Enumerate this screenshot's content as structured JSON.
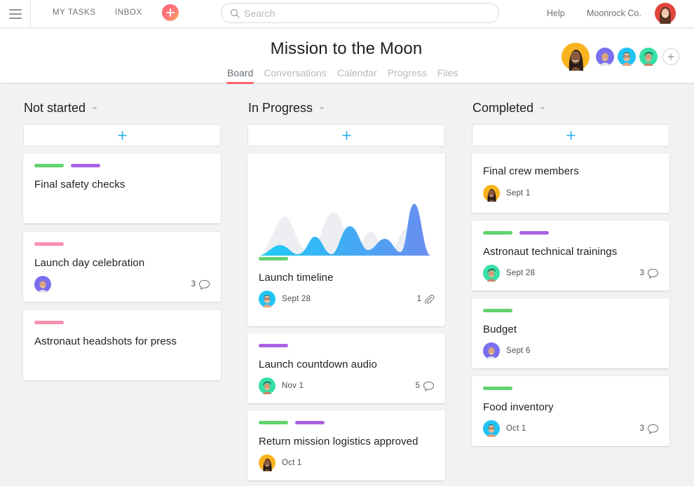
{
  "topbar": {
    "menu_icon": "hamburger-icon",
    "my_tasks": "MY TASKS",
    "inbox": "INBOX",
    "quick_add_icon": "plus-icon",
    "search_placeholder": "Search",
    "search_value": "",
    "help": "Help",
    "organization": "Moonrock Co.",
    "user_avatar": "user-avatar"
  },
  "project": {
    "title": "Mission to the Moon",
    "tabs": [
      {
        "label": "Board",
        "active": true
      },
      {
        "label": "Conversations",
        "active": false
      },
      {
        "label": "Calendar",
        "active": false
      },
      {
        "label": "Progress",
        "active": false
      },
      {
        "label": "Files",
        "active": false
      }
    ],
    "members": [
      {
        "id": "m-orange",
        "color": "#f9b31d"
      },
      {
        "id": "m-purple",
        "color": "#7a6ff0"
      },
      {
        "id": "m-blue",
        "color": "#20c4f4"
      },
      {
        "id": "m-teal",
        "color": "#37e0a7"
      }
    ]
  },
  "colors": {
    "accent": "#fc636b",
    "add_blue": "#20aaea",
    "tag_green": "#62d26f",
    "tag_purple": "#aa62e3",
    "tag_pink": "#fa91ae"
  },
  "columns": [
    {
      "title": "Not started",
      "cards": [
        {
          "tags": [
            "green",
            "purple"
          ],
          "title": "Final safety checks"
        },
        {
          "tags": [
            "pink"
          ],
          "title": "Launch day celebration",
          "assignee": "m-purple",
          "comments": "3"
        },
        {
          "tags": [
            "pink"
          ],
          "title": "Astronaut headshots for press"
        }
      ]
    },
    {
      "title": "In Progress",
      "cards": [
        {
          "image": "wave-chart",
          "tags": [
            "green"
          ],
          "title": "Launch timeline",
          "assignee": "m-blue",
          "due": "Sept 28",
          "attachments": "1"
        },
        {
          "tags": [
            "purple"
          ],
          "title": "Launch countdown audio",
          "assignee": "m-teal",
          "due": "Nov 1",
          "comments": "5"
        },
        {
          "tags": [
            "green",
            "purple"
          ],
          "title": "Return mission logistics approved",
          "assignee": "m-orange",
          "due": "Oct 1"
        }
      ]
    },
    {
      "title": "Completed",
      "cards": [
        {
          "tags": [],
          "title": "Final crew members",
          "assignee": "m-orange",
          "due": "Sept 1"
        },
        {
          "tags": [
            "green",
            "purple"
          ],
          "title": "Astronaut technical trainings",
          "assignee": "m-teal",
          "due": "Sept 28",
          "comments": "3"
        },
        {
          "tags": [
            "green"
          ],
          "title": "Budget",
          "assignee": "m-purple",
          "due": "Sept 6"
        },
        {
          "tags": [
            "green"
          ],
          "title": "Food inventory",
          "assignee": "m-blue",
          "due": "Oct 1",
          "comments": "3"
        }
      ]
    }
  ]
}
